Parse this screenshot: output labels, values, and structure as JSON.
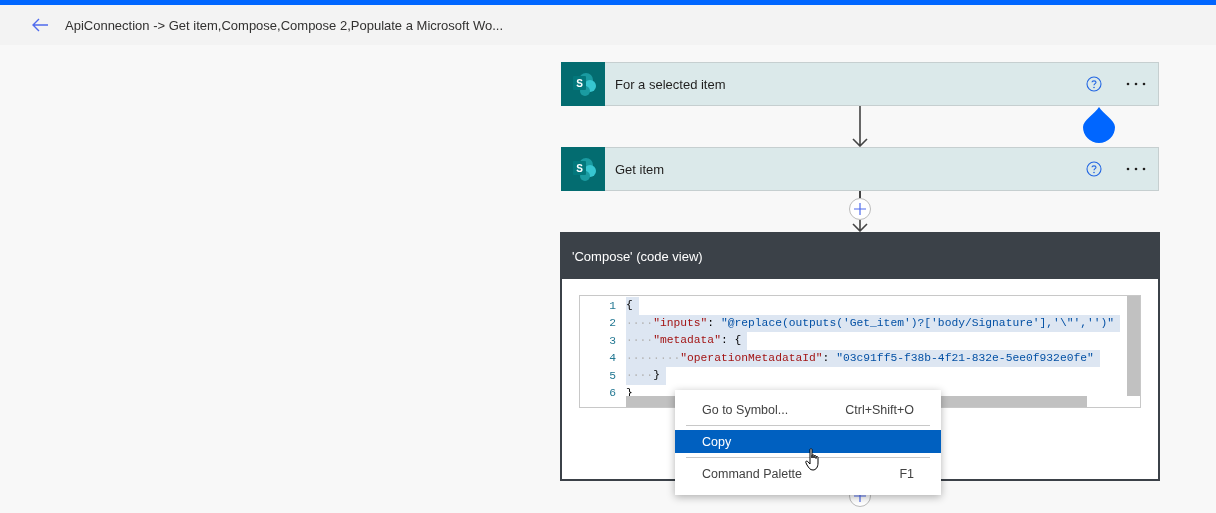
{
  "header": {
    "title": "ApiConnection -> Get item,Compose,Compose 2,Populate a Microsoft Wo..."
  },
  "steps": [
    {
      "kind": "action",
      "logo_text": "S",
      "title": "For a selected item",
      "connector": {
        "kind": "arrow"
      }
    },
    {
      "kind": "action",
      "logo_text": "S",
      "title": "Get item",
      "connector": {
        "kind": "insert"
      }
    },
    {
      "kind": "code",
      "title": "'Compose' (code view)",
      "connector": {
        "kind": "add"
      },
      "code_lines": [
        {
          "number": "1",
          "selected": true,
          "tokens": [
            {
              "kind": "punct",
              "text": "{"
            }
          ]
        },
        {
          "number": "2",
          "selected": true,
          "tokens": [
            {
              "kind": "whitespace",
              "text": "····"
            },
            {
              "kind": "key",
              "text": "\"inputs\""
            },
            {
              "kind": "punct",
              "text": ": "
            },
            {
              "kind": "string",
              "text": "\"@replace(outputs('Get_item')?['body/Signature'],'\\\"','')\""
            }
          ]
        },
        {
          "number": "3",
          "selected": true,
          "tokens": [
            {
              "kind": "whitespace",
              "text": "····"
            },
            {
              "kind": "key",
              "text": "\"metadata\""
            },
            {
              "kind": "punct",
              "text": ": {"
            }
          ]
        },
        {
          "number": "4",
          "selected": true,
          "tokens": [
            {
              "kind": "whitespace",
              "text": "········"
            },
            {
              "kind": "key",
              "text": "\"operationMetadataId\""
            },
            {
              "kind": "punct",
              "text": ": "
            },
            {
              "kind": "string",
              "text": "\"03c91ff5-f38b-4f21-832e-5ee0f932e0fe\""
            }
          ]
        },
        {
          "number": "5",
          "selected": true,
          "tokens": [
            {
              "kind": "whitespace",
              "text": "····"
            },
            {
              "kind": "punct",
              "text": "}"
            }
          ]
        },
        {
          "number": "6",
          "selected": false,
          "tokens": [
            {
              "kind": "punct",
              "text": "}"
            }
          ]
        }
      ]
    }
  ],
  "context_menu": {
    "items": [
      {
        "label": "Go to Symbol...",
        "shortcut": "Ctrl+Shift+O",
        "selected": false
      },
      {
        "label": "Copy",
        "selected": true
      },
      {
        "label": "Command Palette",
        "shortcut": "F1",
        "selected": false
      }
    ]
  }
}
